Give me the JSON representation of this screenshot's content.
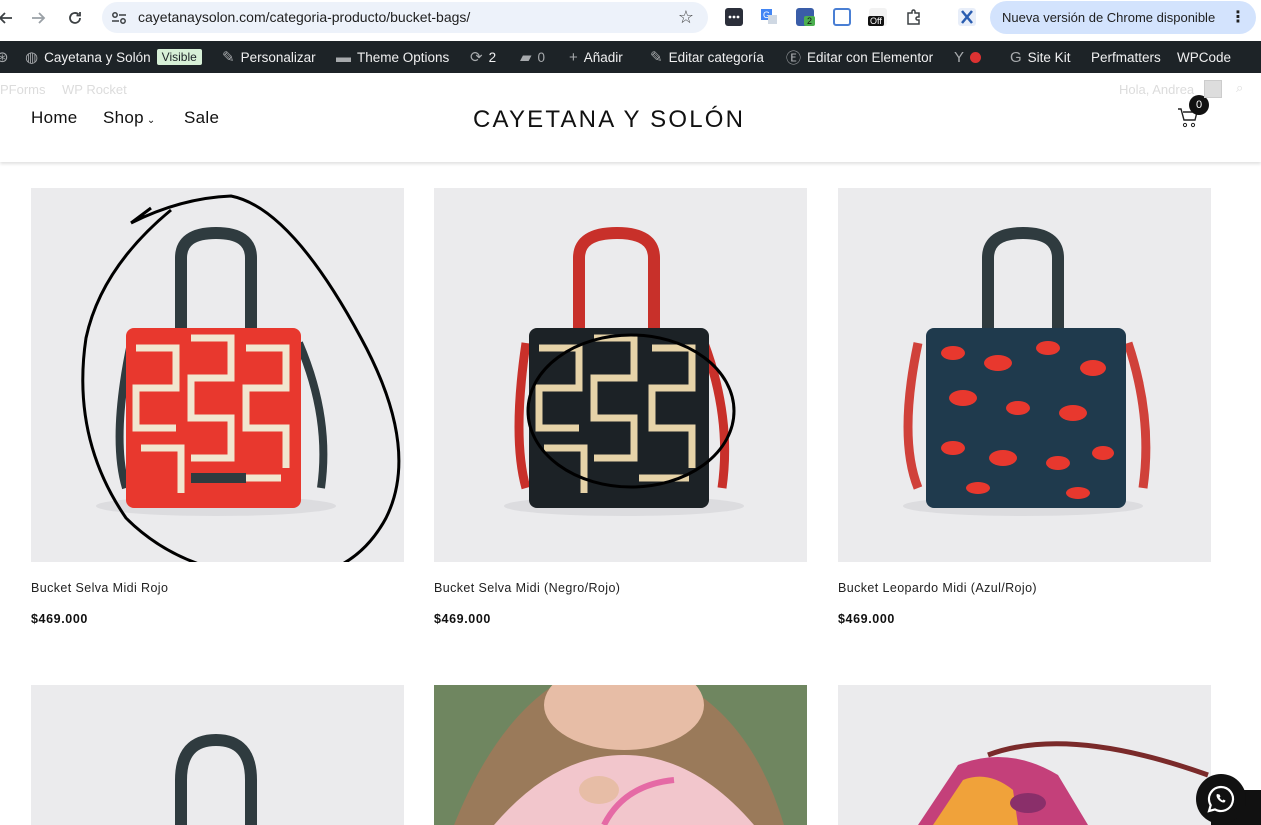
{
  "browser": {
    "url": "cayetanaysolon.com/categoria-producto/bucket-bags/",
    "update_label": "Nueva versión de Chrome disponible",
    "ext_badge_count": "2",
    "ext_off_label": "Off",
    "icons": [
      "back-icon",
      "forward-icon",
      "reload-icon",
      "site-settings-icon",
      "bookmark-star-icon",
      "puzzle-icon",
      "kebab-menu-icon"
    ]
  },
  "admin_bar": {
    "site_name": "Cayetana y Solón",
    "visible_badge": "Visible",
    "customize": "Personalizar",
    "theme_options": "Theme Options",
    "updates_count": "2",
    "comments_count": "0",
    "add_new": "Añadir",
    "edit_category": "Editar categoría",
    "edit_elementor": "Editar con Elementor",
    "site_kit": "Site Kit",
    "perfmatters": "Perfmatters",
    "wpcode": "WPCode"
  },
  "ghost_row": {
    "wpforms": "PForms",
    "wp_rocket": "WP Rocket",
    "greeting": "Hola, Andrea"
  },
  "header": {
    "nav": {
      "home": "Home",
      "shop": "Shop",
      "sale": "Sale"
    },
    "logo": "CAYETANA Y SOLÓN",
    "cart_count": "0"
  },
  "products": [
    {
      "name": "Bucket Selva Midi Rojo",
      "price": "$469.000"
    },
    {
      "name": "Bucket Selva Midi (Negro/Rojo)",
      "price": "$469.000"
    },
    {
      "name": "Bucket Leopardo Midi (Azul/Rojo)",
      "price": "$469.000"
    }
  ],
  "colors": {
    "admin_bar_bg": "#1d2327",
    "update_pill": "#d3e3fd",
    "omnibox": "#edf2fa",
    "product_bg": "#ebebed",
    "bag_red": "#e8382e",
    "bag_cream": "#f1e6cf",
    "bag_navy": "#1f3a4d",
    "strap_dark": "#2f3b3f",
    "strap_red": "#c8302a"
  }
}
